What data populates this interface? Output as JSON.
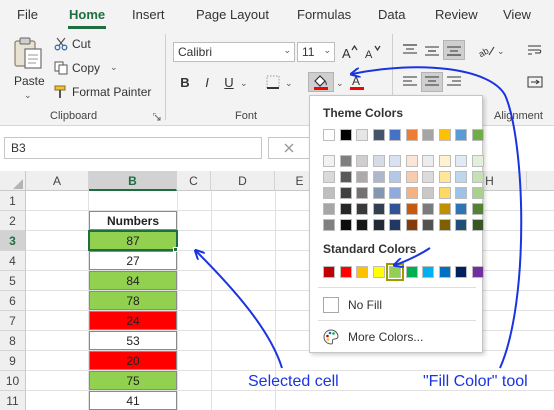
{
  "menu": {
    "tabs": [
      "File",
      "Home",
      "Insert",
      "Page Layout",
      "Formulas",
      "Data",
      "Review",
      "View"
    ],
    "active_index": 1
  },
  "clipboard": {
    "paste_label": "Paste",
    "cut_label": "Cut",
    "copy_label": "Copy",
    "format_painter_label": "Format Painter",
    "group_label": "Clipboard"
  },
  "font": {
    "font_name": "Calibri",
    "font_size": "11",
    "bold_label": "B",
    "italic_label": "I",
    "underline_label": "U",
    "group_label": "Font"
  },
  "alignment": {
    "group_label": "Alignment"
  },
  "formula_bar": {
    "name_box": "B3"
  },
  "columns": [
    "A",
    "B",
    "C",
    "D",
    "E",
    "H"
  ],
  "rows": [
    "1",
    "2",
    "3",
    "4",
    "5",
    "6",
    "7",
    "8",
    "9",
    "10",
    "11"
  ],
  "selected_column": "B",
  "selected_row": "3",
  "table": {
    "header": "Numbers",
    "cells": [
      {
        "value": "87",
        "fill": "#92d050"
      },
      {
        "value": "27",
        "fill": "#ffffff"
      },
      {
        "value": "84",
        "fill": "#92d050"
      },
      {
        "value": "78",
        "fill": "#92d050"
      },
      {
        "value": "24",
        "fill": "#ff0000"
      },
      {
        "value": "53",
        "fill": "#ffffff"
      },
      {
        "value": "20",
        "fill": "#ff0000"
      },
      {
        "value": "75",
        "fill": "#92d050"
      },
      {
        "value": "41",
        "fill": "#ffffff"
      }
    ]
  },
  "palette": {
    "theme_title": "Theme Colors",
    "theme_top": [
      "#ffffff",
      "#000000",
      "#e7e6e6",
      "#44546a",
      "#4472c4",
      "#ed7d31",
      "#a5a5a5",
      "#ffc000",
      "#5b9bd5",
      "#70ad47"
    ],
    "theme_shades": [
      [
        "#f2f2f2",
        "#d9d9d9",
        "#bfbfbf",
        "#a6a6a6",
        "#808080"
      ],
      [
        "#7f7f7f",
        "#595959",
        "#404040",
        "#262626",
        "#0d0d0d"
      ],
      [
        "#d0cece",
        "#aeaaaa",
        "#757171",
        "#3a3838",
        "#171616"
      ],
      [
        "#d6dce5",
        "#adb9ca",
        "#8497b0",
        "#333f50",
        "#222a35"
      ],
      [
        "#d9e2f3",
        "#b4c7e7",
        "#8faadc",
        "#2f5597",
        "#203864"
      ],
      [
        "#fbe5d6",
        "#f8cbad",
        "#f4b183",
        "#c55a11",
        "#843c0c"
      ],
      [
        "#ededed",
        "#dbdbdb",
        "#c9c9c9",
        "#7b7b7b",
        "#525252"
      ],
      [
        "#fff2cc",
        "#ffe699",
        "#ffd966",
        "#bf9000",
        "#7f6000"
      ],
      [
        "#deebf7",
        "#bdd7ee",
        "#9dc3e6",
        "#2e75b6",
        "#1f4e79"
      ],
      [
        "#e2f0d9",
        "#c5e0b4",
        "#a9d18e",
        "#538135",
        "#375623"
      ]
    ],
    "standard_title": "Standard Colors",
    "standard": [
      "#c00000",
      "#ff0000",
      "#ffc000",
      "#ffff00",
      "#92d050",
      "#00b050",
      "#00b0f0",
      "#0070c0",
      "#002060",
      "#7030a0"
    ],
    "highlighted_standard_index": 4,
    "no_fill_label": "No Fill",
    "more_colors_label": "More Colors..."
  },
  "annotations": {
    "selected_cell": "Selected cell",
    "fill_color_tool": "\"Fill Color\" tool"
  },
  "colors": {
    "accent_green": "#1e6e42",
    "annotation_blue": "#1a34e0",
    "fill_green": "#92d050",
    "fill_red": "#ff0000"
  }
}
